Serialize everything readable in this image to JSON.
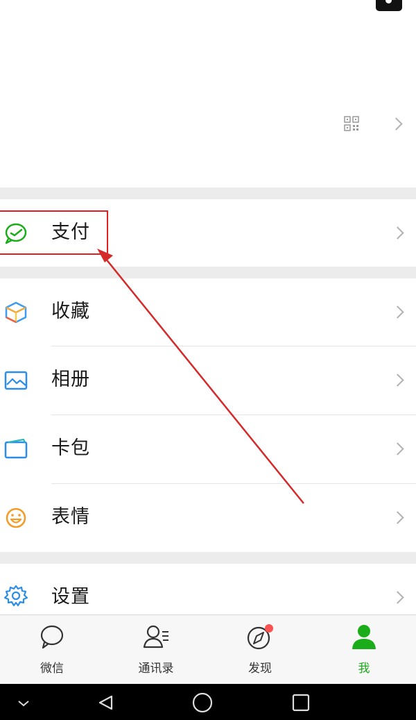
{
  "profile": {
    "qr_icon": "qr-code-icon"
  },
  "menu": {
    "pay": {
      "label": "支付",
      "icon": "wallet-check-icon"
    },
    "group2": [
      {
        "label": "收藏",
        "icon": "cube-icon"
      },
      {
        "label": "相册",
        "icon": "photo-icon"
      },
      {
        "label": "卡包",
        "icon": "card-icon"
      },
      {
        "label": "表情",
        "icon": "smiley-icon"
      }
    ],
    "settings": {
      "label": "设置",
      "icon": "gear-icon"
    }
  },
  "tabbar": {
    "tabs": [
      {
        "label": "微信",
        "icon": "chat-bubble-icon",
        "active": false
      },
      {
        "label": "通讯录",
        "icon": "contacts-icon",
        "active": false
      },
      {
        "label": "发现",
        "icon": "compass-icon",
        "active": false,
        "badge": true
      },
      {
        "label": "我",
        "icon": "person-icon",
        "active": true
      }
    ]
  },
  "colors": {
    "accent": "#1aad19",
    "annotation": "#e02020",
    "badge": "#fa5151",
    "background_gap": "#ececec"
  }
}
